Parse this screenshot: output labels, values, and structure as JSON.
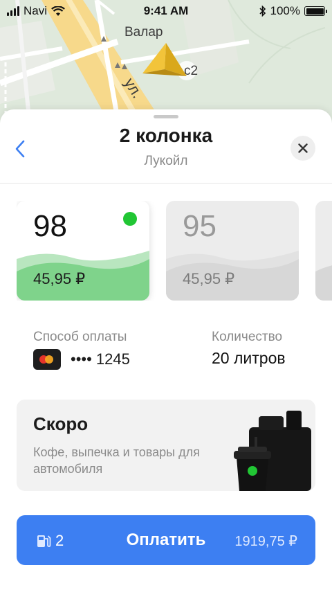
{
  "status_bar": {
    "carrier": "Navi",
    "time": "9:41 AM",
    "battery": "100%"
  },
  "map": {
    "label_place": "Валар",
    "label_building": "с2",
    "label_street": "ул. "
  },
  "station": {
    "title": "2 колонка",
    "subtitle": "Лукойл"
  },
  "fuels": [
    {
      "grade": "98",
      "price": "45,95 ₽",
      "selected": true
    },
    {
      "grade": "95",
      "price": "45,95 ₽",
      "selected": false
    }
  ],
  "payment": {
    "label": "Способ оплаты",
    "card_number": "•••• 1245"
  },
  "quantity": {
    "label": "Количество",
    "value": "20 литров"
  },
  "promo": {
    "title": "Скоро",
    "text": "Кофе, выпечка и товары для автомобиля"
  },
  "pay_button": {
    "pump_number": "2",
    "label": "Оплатить",
    "amount": "1919,75 ₽"
  },
  "colors": {
    "accent": "#3d7ff2",
    "selected_green": "#21c634",
    "card_wave_green": "#7fd38b"
  },
  "icons": {
    "back": "chevron-left-icon",
    "close": "close-icon",
    "navigation": "navigation-arrow-icon",
    "fuel": "fuel-pump-icon"
  }
}
